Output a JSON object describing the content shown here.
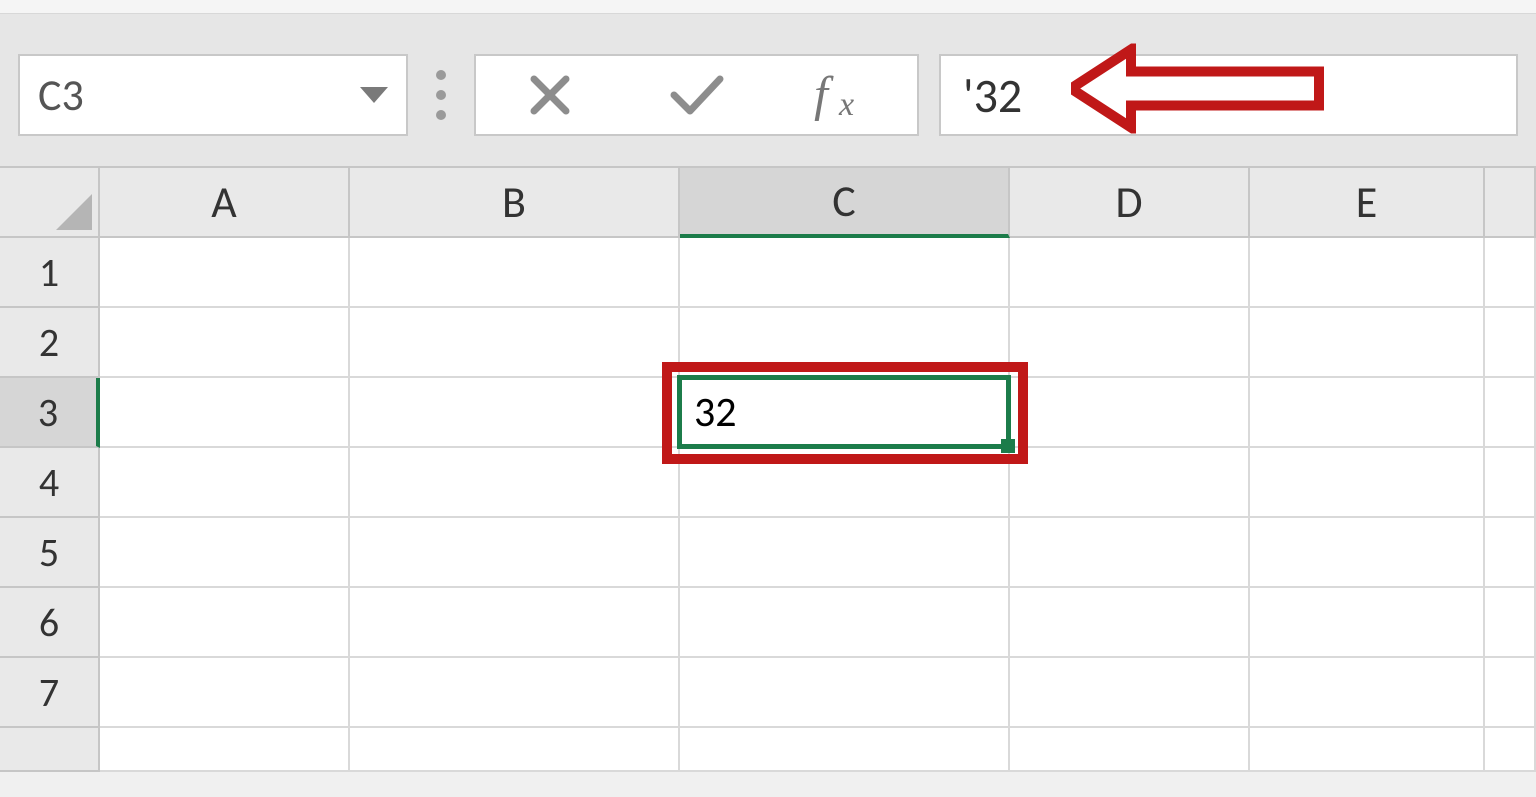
{
  "namebox": {
    "value": "C3"
  },
  "formula_bar": {
    "text": "'32"
  },
  "columns": [
    "A",
    "B",
    "C",
    "D",
    "E"
  ],
  "rows": [
    "1",
    "2",
    "3",
    "4",
    "5",
    "6",
    "7"
  ],
  "active": {
    "col": "C",
    "row": "3"
  },
  "cells": {
    "C3": "32"
  },
  "annotations": {
    "arrow_color": "#c01818",
    "highlight_color": "#c01818"
  }
}
